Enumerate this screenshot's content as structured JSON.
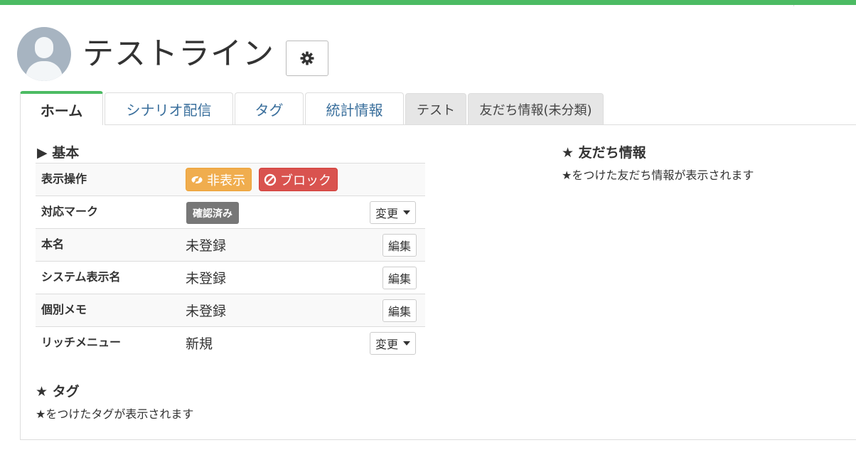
{
  "header": {
    "title": "テストライン",
    "avatar_icon": "user-avatar-icon",
    "settings_icon": "gear-icon"
  },
  "tabs": [
    {
      "label": "ホーム",
      "active": true
    },
    {
      "label": "シナリオ配信"
    },
    {
      "label": "タグ"
    },
    {
      "label": "統計情報"
    },
    {
      "label": "テスト"
    },
    {
      "label": "友だち情報(未分類)"
    }
  ],
  "basic": {
    "title": "▶ 基本",
    "rows": {
      "display_ops": {
        "label": "表示操作",
        "hide_label": "非表示",
        "block_label": "ブロック"
      },
      "mark": {
        "label": "対応マーク",
        "badge": "確認済み",
        "change_label": "変更"
      },
      "real_name": {
        "label": "本名",
        "value": "未登録",
        "edit_label": "編集"
      },
      "system_name": {
        "label": "システム表示名",
        "value": "未登録",
        "edit_label": "編集"
      },
      "memo": {
        "label": "個別メモ",
        "value": "未登録",
        "edit_label": "編集"
      },
      "rich_menu": {
        "label": "リッチメニュー",
        "value": "新規",
        "change_label": "変更"
      }
    }
  },
  "tags": {
    "title": "★ タグ",
    "hint": "★をつけたタグが表示されます"
  },
  "friend_info": {
    "title": "★ 友だち情報",
    "hint": "★をつけた友だち情報が表示されます"
  },
  "colors": {
    "accent": "#4cbb63",
    "warning": "#f0ad4e",
    "danger": "#d9534f",
    "badge": "#777777",
    "link": "#3a6f9c"
  }
}
